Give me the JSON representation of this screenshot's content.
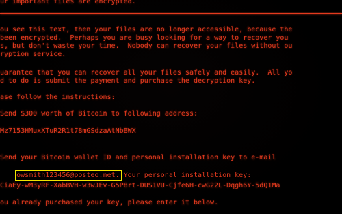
{
  "top_line": "ur important files are encrypted.",
  "paragraph1": [
    "ou see this text, then your files are no longer accessible, because the",
    "been encrypted.  Perhaps you are busy looking for a way to recover you",
    "s, but don't waste your time.  Nobody can recover your files without ou",
    "ryption service."
  ],
  "paragraph2": [
    "uarantee that you can recover all your files safely and easily.  All yo",
    "d to do is submit the payment and purchase the decryption key."
  ],
  "instructions_header": "ase follow the instructions:",
  "step1": "Send $300 worth of Bitcoin to following address:",
  "bitcoin_address": "Mz7153HMuxXTuR2R1t78mGSdzaAtNbBWX",
  "step2": "Send your Bitcoin wallet ID and personal installation key to e-mail",
  "email": "owsmith123456@posteo.net.",
  "email_suffix": "Your personal installation key:",
  "installation_key": "CiaEy-wM3yRF-XabBVH-w3wJEv-G5P8rt-DUS1VU-Cjfe6H-cwG22L-Dqgh6Y-5dQ1Ma",
  "final_line": "ou already purchased your key, please enter it below.",
  "colors": {
    "background": "#000000",
    "text": "#e33a1e",
    "highlight_box": "#f2e600"
  }
}
